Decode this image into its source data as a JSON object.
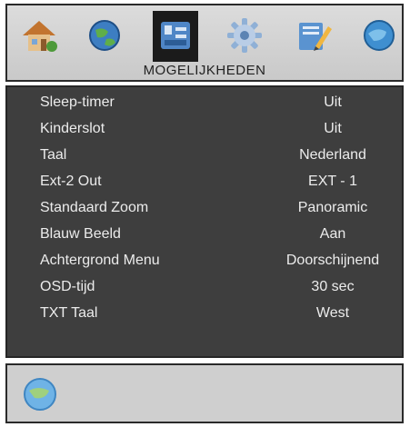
{
  "header": {
    "title": "MOGELIJKHEDEN",
    "icons": [
      {
        "name": "home-icon",
        "selected": false
      },
      {
        "name": "globe-sound-icon",
        "selected": false
      },
      {
        "name": "features-icon",
        "selected": true
      },
      {
        "name": "gear-icon",
        "selected": false
      },
      {
        "name": "edit-icon",
        "selected": false
      },
      {
        "name": "source-globe-icon",
        "selected": false
      }
    ]
  },
  "settings": [
    {
      "label": "Sleep-timer",
      "value": "Uit"
    },
    {
      "label": "Kinderslot",
      "value": "Uit"
    },
    {
      "label": "Taal",
      "value": "Nederland"
    },
    {
      "label": "Ext-2 Out",
      "value": "EXT - 1"
    },
    {
      "label": "Standaard Zoom",
      "value": "Panoramic"
    },
    {
      "label": "Blauw Beeld",
      "value": "Aan"
    },
    {
      "label": "Achtergrond Menu",
      "value": "Doorschijnend"
    },
    {
      "label": "OSD-tijd",
      "value": "30 sec"
    },
    {
      "label": "TXT Taal",
      "value": "West"
    }
  ],
  "footer": {
    "help_icon": "globe-help-icon"
  },
  "colors": {
    "panel_background": "#3e3e3e",
    "text": "#ececec",
    "header_background": "#d4d4d4",
    "selected_icon_background": "#1b1b1b"
  }
}
